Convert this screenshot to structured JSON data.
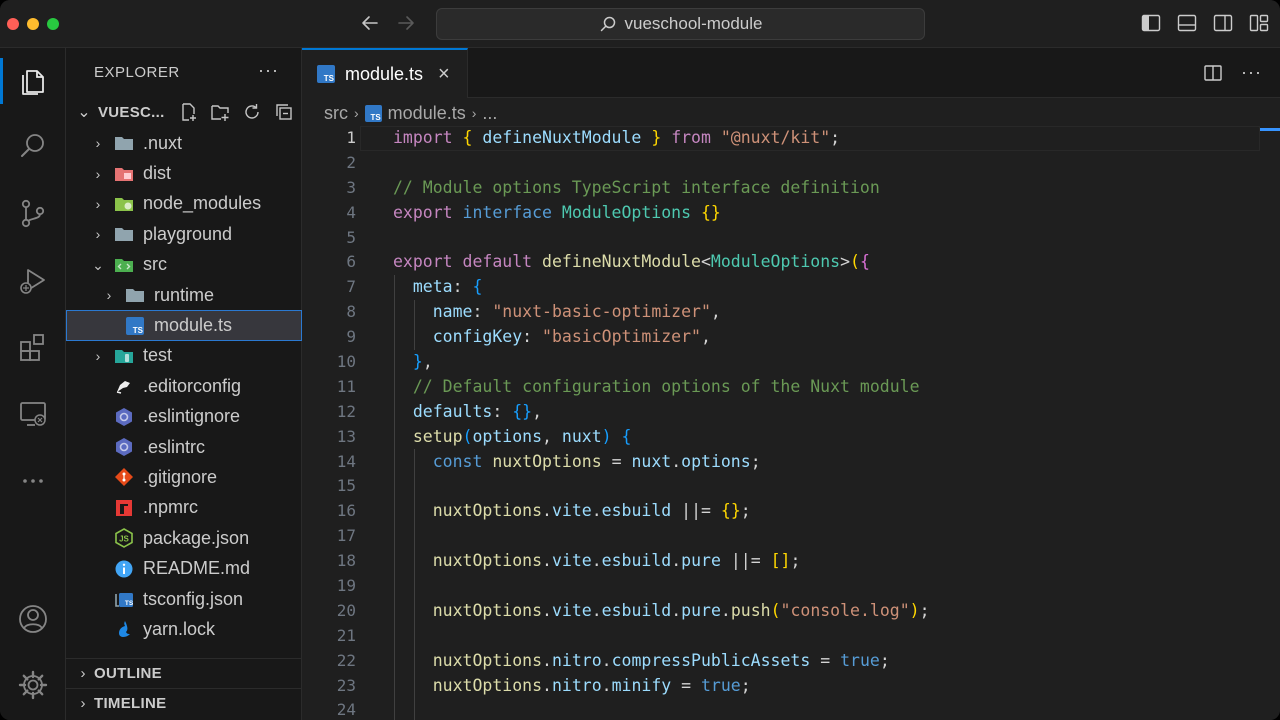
{
  "titlebar": {
    "search_text": "vueschool-module"
  },
  "activitybar": {
    "items": [
      "explorer-icon",
      "search-icon",
      "source-control-icon",
      "run-debug-icon",
      "extensions-icon",
      "remote-explorer-icon",
      "more-icon",
      "account-icon",
      "settings-gear-icon"
    ]
  },
  "sidebar": {
    "title": "EXPLORER",
    "more": "···",
    "section_title": "VUESC...",
    "tree": [
      {
        "label": ".nuxt",
        "type": "folder",
        "icon_color": "#90a4ae"
      },
      {
        "label": "dist",
        "type": "folder",
        "icon_color": "#e57373"
      },
      {
        "label": "node_modules",
        "type": "folder",
        "icon_color": "#8bc34a"
      },
      {
        "label": "playground",
        "type": "folder",
        "icon_color": "#90a4ae"
      },
      {
        "label": "src",
        "type": "folder-open",
        "icon_color": "#4caf50"
      },
      {
        "label": "runtime",
        "type": "folder",
        "icon_color": "#90a4ae"
      },
      {
        "label": "module.ts",
        "type": "ts-file",
        "icon_color": "#3178c6"
      },
      {
        "label": "test",
        "type": "folder",
        "icon_color": "#26a69a"
      },
      {
        "label": ".editorconfig",
        "type": "file",
        "icon_color": "#e0e0e0"
      },
      {
        "label": ".eslintignore",
        "type": "file",
        "icon_color": "#5c6bc0"
      },
      {
        "label": ".eslintrc",
        "type": "file",
        "icon_color": "#5c6bc0"
      },
      {
        "label": ".gitignore",
        "type": "file",
        "icon_color": "#e64a19"
      },
      {
        "label": ".npmrc",
        "type": "file",
        "icon_color": "#e53935"
      },
      {
        "label": "package.json",
        "type": "file",
        "icon_color": "#8bc34a"
      },
      {
        "label": "README.md",
        "type": "file",
        "icon_color": "#42a5f5"
      },
      {
        "label": "tsconfig.json",
        "type": "file",
        "icon_color": "#3178c6"
      },
      {
        "label": "yarn.lock",
        "type": "file",
        "icon_color": "#1e88e5"
      }
    ],
    "outline_title": "OUTLINE",
    "timeline_title": "TIMELINE"
  },
  "editor": {
    "tab_label": "module.ts",
    "tab_close": "×",
    "more": "···",
    "breadcrumb": [
      "src",
      "module.ts",
      "..."
    ],
    "current_line": 1,
    "line_numbers": [
      "1",
      "2",
      "3",
      "4",
      "5",
      "6",
      "7",
      "8",
      "9",
      "10",
      "11",
      "12",
      "13",
      "14",
      "15",
      "16",
      "17",
      "18",
      "19",
      "20",
      "21",
      "22",
      "23",
      "24"
    ],
    "code_lines": [
      "import { defineNuxtModule } from \"@nuxt/kit\";",
      "",
      "// Module options TypeScript interface definition",
      "export interface ModuleOptions {}",
      "",
      "export default defineNuxtModule<ModuleOptions>({",
      "  meta: {",
      "    name: \"nuxt-basic-optimizer\",",
      "    configKey: \"basicOptimizer\",",
      "  },",
      "  // Default configuration options of the Nuxt module",
      "  defaults: {},",
      "  setup(options, nuxt) {",
      "    const nuxtOptions = nuxt.options;",
      "",
      "    nuxtOptions.vite.esbuild ||= {};",
      "",
      "    nuxtOptions.vite.esbuild.pure ||= [];",
      "",
      "    nuxtOptions.vite.esbuild.pure.push(\"console.log\");",
      "",
      "    nuxtOptions.nitro.compressPublicAssets = true;",
      "    nuxtOptions.nitro.minify = true;",
      ""
    ]
  },
  "colors": {
    "accent": "#0078d4",
    "editor_bg": "#1f1f1f",
    "sidebar_bg": "#181818",
    "keyword": "#c586c0",
    "string": "#ce9178",
    "comment": "#6a9955",
    "function": "#dcdcaa",
    "type": "#4ec9b0",
    "property": "#9cdcfe"
  }
}
